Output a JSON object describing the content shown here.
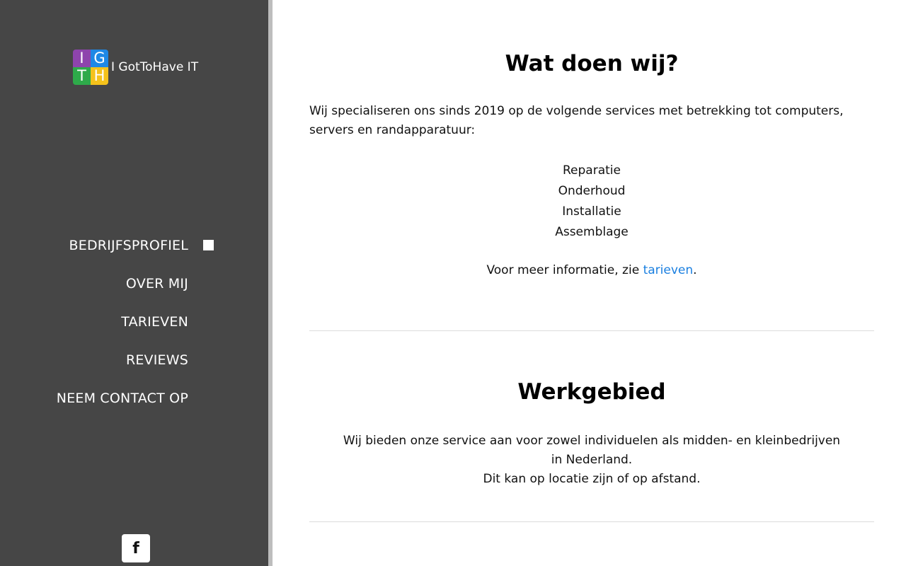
{
  "brand": {
    "name": "I GotToHave IT",
    "logo_letters": [
      "I",
      "G",
      "T",
      "H"
    ],
    "logo_colors": [
      "#8e44ad",
      "#1e88e5",
      "#2eaa4a",
      "#f5c21b"
    ]
  },
  "nav": {
    "items": [
      {
        "label": "BEDRIJFSPROFIEL",
        "active": true
      },
      {
        "label": "OVER MIJ",
        "active": false
      },
      {
        "label": "TARIEVEN",
        "active": false
      },
      {
        "label": "REVIEWS",
        "active": false
      },
      {
        "label": "NEEM CONTACT OP",
        "active": false
      }
    ]
  },
  "social": {
    "facebook_glyph": "f",
    "icon": "facebook-icon"
  },
  "section1": {
    "title": "Wat doen wij?",
    "intro": "Wij specialiseren ons sinds 2019 op de volgende services met betrekking tot computers, servers en randapparatuur:",
    "services": [
      "Reparatie",
      "Onderhoud",
      "Installatie",
      "Assemblage"
    ],
    "more_prefix": "Voor meer informatie, zie ",
    "more_link": "tarieven",
    "more_suffix": "."
  },
  "section2": {
    "title": "Werkgebied",
    "line1": "Wij bieden onze service aan voor zowel individuelen als midden- en kleinbedrijven in Nederland.",
    "line2": "Dit kan op locatie zijn of op afstand."
  },
  "colors": {
    "sidebar": "#464646",
    "link": "#1a7fe0"
  }
}
